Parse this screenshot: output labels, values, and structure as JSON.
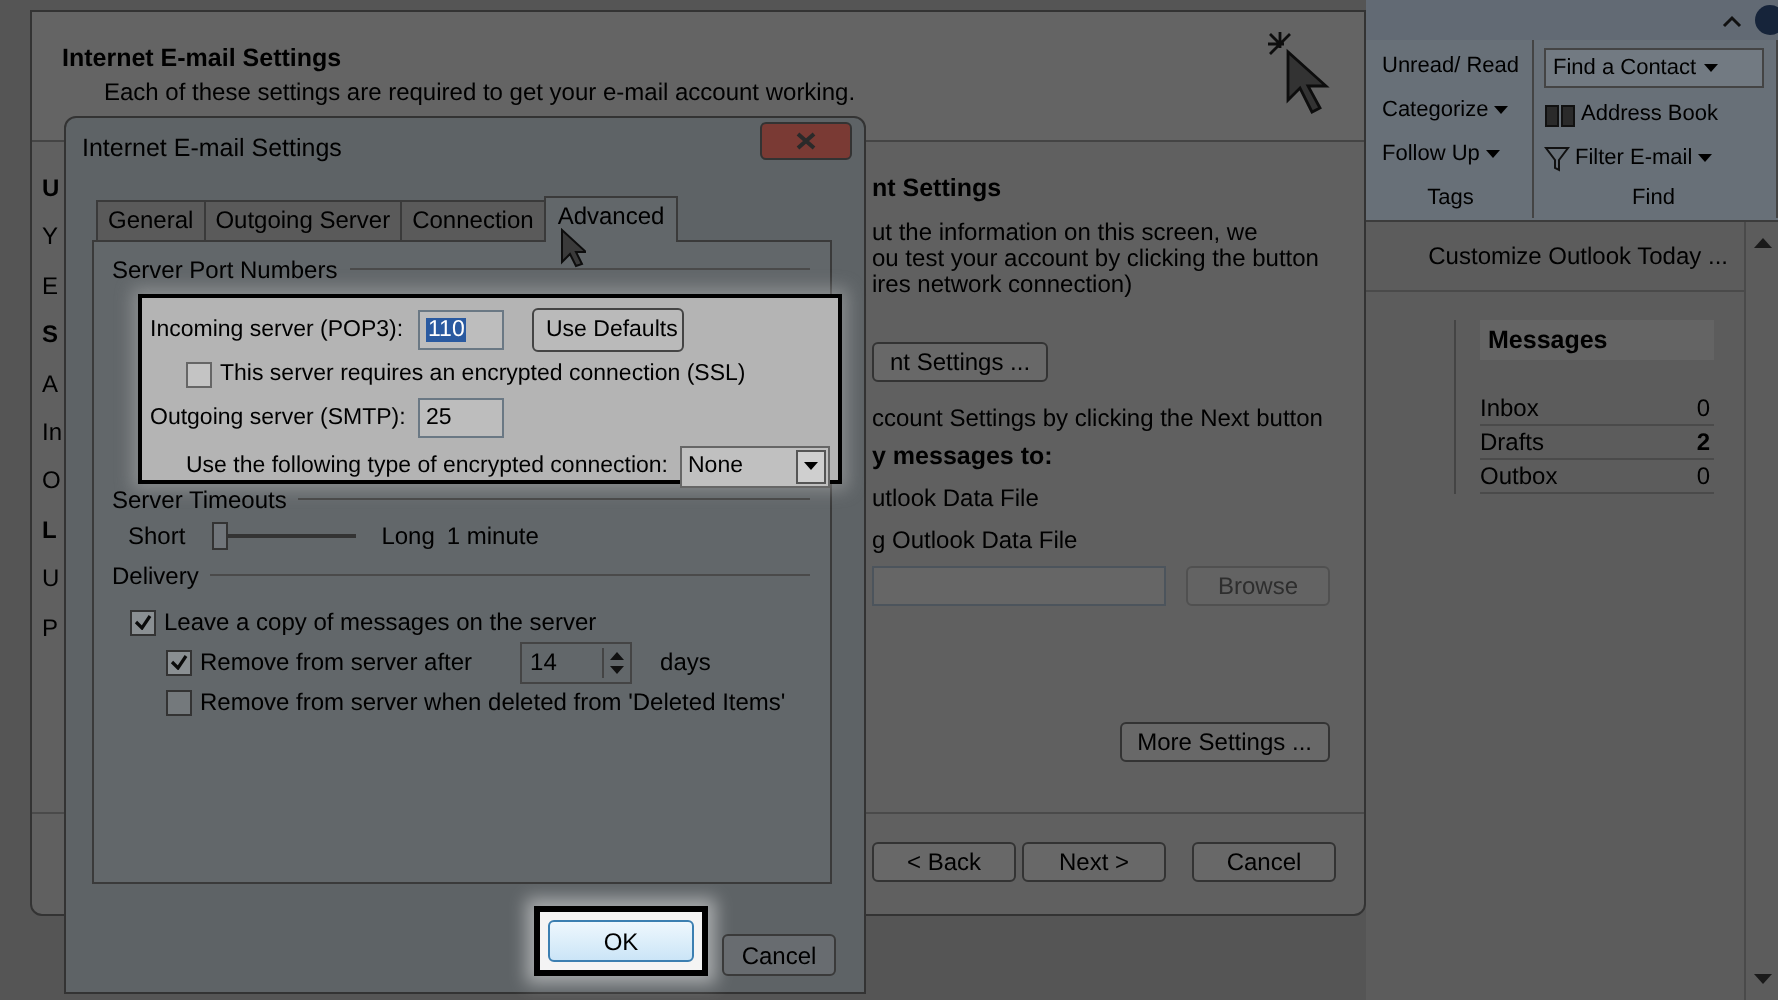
{
  "outlook": {
    "ribbon": {
      "tags_group": {
        "label": "Tags",
        "items": [
          {
            "label": "Unread/ Read",
            "dropdown": false
          },
          {
            "label": "Categorize",
            "dropdown": true
          },
          {
            "label": "Follow Up",
            "dropdown": true
          }
        ]
      },
      "find_group": {
        "label": "Find",
        "search": {
          "value": "Find a Contact",
          "dropdown": true
        },
        "items": [
          {
            "label": "Address Book",
            "kind": "book",
            "dropdown": false
          },
          {
            "label": "Filter E-mail",
            "kind": "filter",
            "dropdown": true
          }
        ]
      }
    },
    "customize_link": "Customize Outlook Today ...",
    "messages": {
      "title": "Messages",
      "rows": [
        {
          "name": "Inbox",
          "count": "0",
          "bold": false
        },
        {
          "name": "Drafts",
          "count": "2",
          "bold": true
        },
        {
          "name": "Outbox",
          "count": "0",
          "bold": false
        }
      ]
    }
  },
  "wizard": {
    "title": "Internet E-mail Settings",
    "subtitle": "Each of these settings are required to get your e-mail account working.",
    "left_fragments": [
      {
        "text": "U",
        "kind": "heading"
      },
      {
        "text": "Y",
        "kind": "text"
      },
      {
        "text": "E",
        "kind": "text"
      },
      {
        "text": "S",
        "kind": "heading"
      },
      {
        "text": "A",
        "kind": "text"
      },
      {
        "text": "In",
        "kind": "text"
      },
      {
        "text": "O",
        "kind": "text"
      },
      {
        "text": "L",
        "kind": "heading"
      },
      {
        "text": "U",
        "kind": "text"
      },
      {
        "text": "P",
        "kind": "text"
      }
    ],
    "right_items": [
      {
        "kind": "heading",
        "text": "nt Settings"
      },
      {
        "kind": "paragraph",
        "lines": [
          "ut the information on this screen, we",
          "ou test your account by clicking the button",
          "ires network connection)"
        ]
      },
      {
        "kind": "button",
        "text": "nt Settings ..."
      },
      {
        "kind": "text",
        "text": "ccount Settings by clicking the Next button"
      },
      {
        "kind": "heading",
        "text": "y messages to:"
      },
      {
        "kind": "option",
        "text": "utlook Data File"
      },
      {
        "kind": "option",
        "text": "g Outlook Data File"
      },
      {
        "kind": "file",
        "button": "Browse",
        "disabled": true
      },
      {
        "kind": "more",
        "text": "More Settings ..."
      }
    ],
    "buttons": [
      {
        "label": "< Back"
      },
      {
        "label": "Next >"
      },
      {
        "label": "Cancel"
      }
    ]
  },
  "dialog": {
    "title": "Internet E-mail Settings",
    "tabs": [
      {
        "label": "General",
        "selected": false
      },
      {
        "label": "Outgoing Server",
        "selected": false
      },
      {
        "label": "Connection",
        "selected": false
      },
      {
        "label": "Advanced",
        "selected": true
      }
    ],
    "port_section": {
      "title": "Server Port Numbers",
      "spotlight": true
    },
    "incoming": {
      "label": "Incoming server (POP3):",
      "value": "110",
      "text_selected": true,
      "button": "Use Defaults"
    },
    "ssl": {
      "label": "This server requires an encrypted connection (SSL)",
      "checked": false
    },
    "outgoing": {
      "label": "Outgoing server (SMTP):",
      "value": "25",
      "text_selected": false
    },
    "encryption": {
      "label": "Use the following type of encrypted connection:",
      "value": "None"
    },
    "timeouts": {
      "title": "Server Timeouts",
      "min_label": "Short",
      "max_label": "Long",
      "level": 0.05,
      "reading": "1 minute"
    },
    "delivery": {
      "title": "Delivery",
      "options": [
        {
          "label": "Leave a copy of messages on the server",
          "checked": true,
          "kind": "plain",
          "children": [
            {
              "label": "Remove from server after",
              "checked": true,
              "kind": "days",
              "value": "14",
              "unit": "days"
            },
            {
              "label": "Remove from server when deleted from 'Deleted Items'",
              "checked": false,
              "kind": "plain"
            }
          ]
        }
      ]
    },
    "buttons": [
      {
        "label": "OK",
        "highlighted": true
      },
      {
        "label": "Cancel",
        "highlighted": false
      }
    ]
  }
}
